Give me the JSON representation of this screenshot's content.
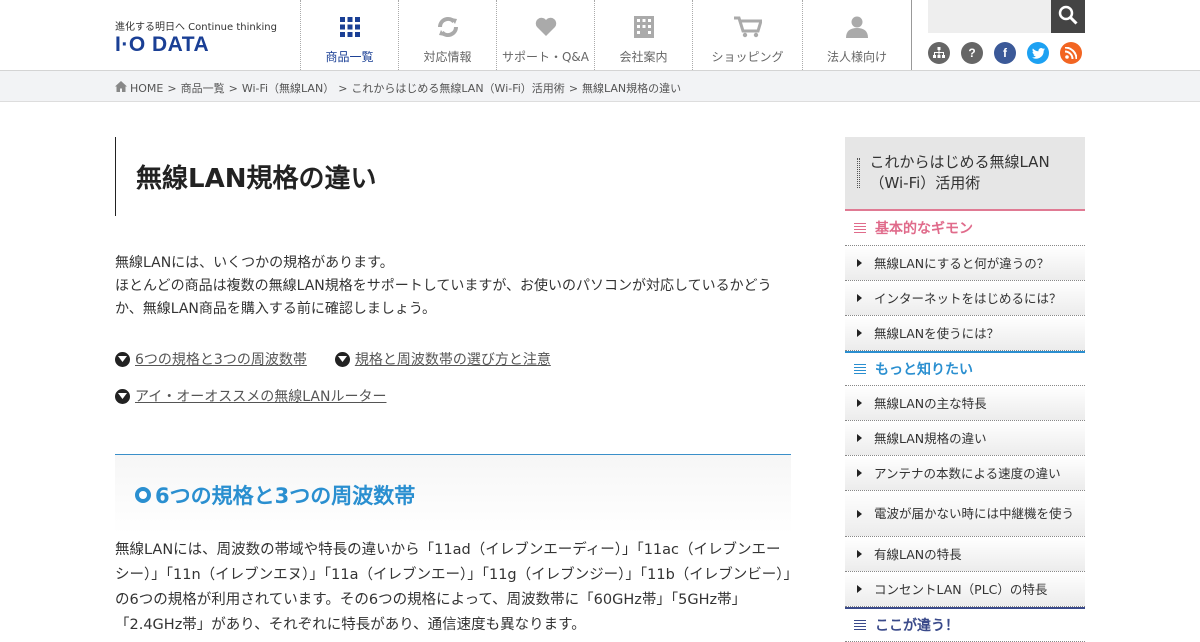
{
  "header": {
    "tagline": "進化する明日へ Continue thinking",
    "logo_text": "I·O DATA",
    "nav": [
      {
        "label": "商品一覧",
        "icon": "grid-icon",
        "active": true
      },
      {
        "label": "対応情報",
        "icon": "refresh-icon",
        "active": false
      },
      {
        "label": "サポート・Q&A",
        "icon": "heart-icon",
        "active": false
      },
      {
        "label": "会社案内",
        "icon": "building-icon",
        "active": false
      },
      {
        "label": "ショッピング",
        "icon": "cart-icon",
        "active": false
      },
      {
        "label": "法人様向け",
        "icon": "person-icon",
        "active": false
      }
    ],
    "search_placeholder": "",
    "sns": [
      {
        "icon": "sitemap-icon",
        "color": "#666666"
      },
      {
        "icon": "help-icon",
        "color": "#666666",
        "glyph": "?"
      },
      {
        "icon": "facebook-icon",
        "color": "#3b5998",
        "glyph": "f"
      },
      {
        "icon": "twitter-icon",
        "color": "#1da1f2"
      },
      {
        "icon": "rss-icon",
        "color": "#f26522"
      }
    ]
  },
  "breadcrumb": [
    "HOME",
    "商品一覧",
    "Wi-Fi（無線LAN）",
    "これからはじめる無線LAN（Wi-Fi）活用術",
    "無線LAN規格の違い"
  ],
  "main": {
    "title": "無線LAN規格の違い",
    "intro_1": "無線LANには、いくつかの規格があります。",
    "intro_2": "ほとんどの商品は複数の無線LAN規格をサポートしていますが、お使いのパソコンが対応しているかどうか、無線LAN商品を購入する前に確認しましょう。",
    "anchors": [
      "6つの規格と3つの周波数帯",
      "規格と周波数帯の選び方と注意",
      "アイ・オーオススメの無線LANルーター"
    ],
    "section_title": "6つの規格と3つの周波数帯",
    "section_body": "無線LANには、周波数の帯域や特長の違いから「11ad（イレブンエーディー）」「11ac（イレブンエーシー）」「11n（イレブンエヌ）」「11a（イレブンエー）」「11g（イレブンジー）」「11b（イレブンビー）」の6つの規格が利用されています。その6つの規格によって、周波数帯に「60GHz帯」「5GHz帯」「2.4GHz帯」があり、それぞれに特長があり、通信速度も異なります。"
  },
  "side": {
    "title": "これからはじめる無線LAN（Wi-Fi）活用術",
    "cat1": "基本的なギモン",
    "cat1_items": [
      "無線LANにすると何が違うの？",
      "インターネットをはじめるには？",
      "無線LANを使うには？"
    ],
    "cat2": "もっと知りたい",
    "cat2_items": [
      "無線LANの主な特長",
      "無線LAN規格の違い",
      "アンテナの本数による速度の違い",
      "電波が届かない時には中継機を使う",
      "有線LANの特長",
      "コンセントLAN（PLC）の特長"
    ],
    "cat3": "ここが違う！"
  },
  "colors": {
    "brand": "#1a3f95",
    "accent_blue": "#2a8fd0",
    "accent_pink": "#e06b8b"
  }
}
